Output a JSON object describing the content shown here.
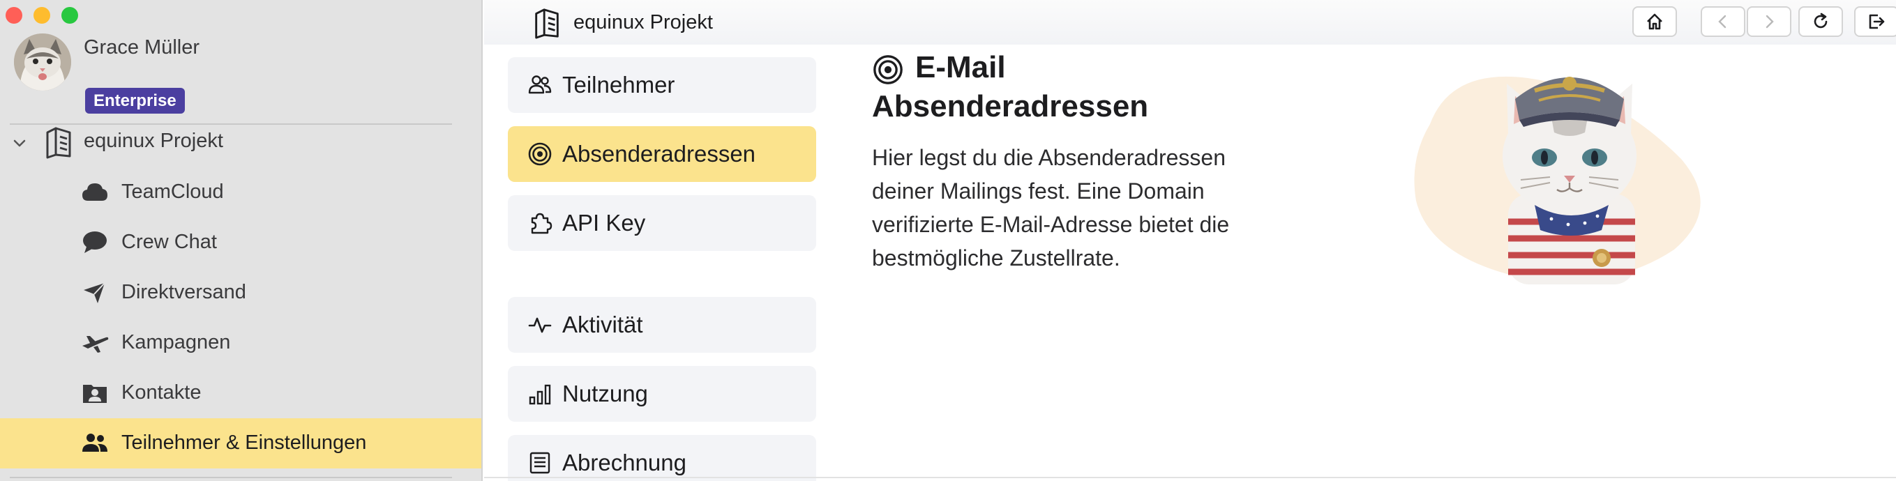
{
  "window": {
    "controls": [
      "close",
      "minimize",
      "zoom"
    ],
    "colors": {
      "close": "#ff5f57",
      "minimize": "#febc2e",
      "zoom": "#28c840"
    }
  },
  "sidebar": {
    "user": {
      "name": "Grace Müller",
      "plan": "Enterprise"
    },
    "project": {
      "name": "equinux Projekt",
      "icon": "project-cube-icon"
    },
    "items": [
      {
        "label": "TeamCloud",
        "icon": "cloud-icon"
      },
      {
        "label": "Crew Chat",
        "icon": "chat-bubble-icon"
      },
      {
        "label": "Direktversand",
        "icon": "paper-plane-icon"
      },
      {
        "label": "Kampagnen",
        "icon": "airplane-icon"
      },
      {
        "label": "Kontakte",
        "icon": "contact-folder-icon"
      },
      {
        "label": "Teilnehmer & Einstellungen",
        "icon": "people-icon",
        "active": true
      }
    ],
    "colors": {
      "background": "#e3e3e3",
      "active": "#fbe38d",
      "badge": "#4b3fa0"
    }
  },
  "toolbar": {
    "title": "equinux Projekt",
    "buttons": [
      "home-icon",
      "back-icon",
      "forward-icon",
      "reload-icon",
      "sign-out-icon"
    ]
  },
  "settings_nav": {
    "items": [
      {
        "label": "Teilnehmer",
        "icon": "people-outline-icon"
      },
      {
        "label": "Absenderadressen",
        "icon": "target-icon",
        "active": true
      },
      {
        "label": "API Key",
        "icon": "puzzle-icon"
      },
      {
        "label": "Aktivität",
        "icon": "activity-pulse-icon"
      },
      {
        "label": "Nutzung",
        "icon": "bar-chart-icon"
      },
      {
        "label": "Abrechnung",
        "icon": "invoice-icon"
      }
    ],
    "colors": {
      "item": "#f3f4f7",
      "active": "#fbe38d"
    }
  },
  "detail": {
    "title_line1": "E-Mail",
    "title_line2": "Absenderadressen",
    "description": "Hier legst du die Absenderadressen deiner Mailings fest. Eine Domain verifizierte E-Mail-Adresse bietet die bestmögliche Zustellrate.",
    "illustration": "cat-captain-mascot"
  }
}
